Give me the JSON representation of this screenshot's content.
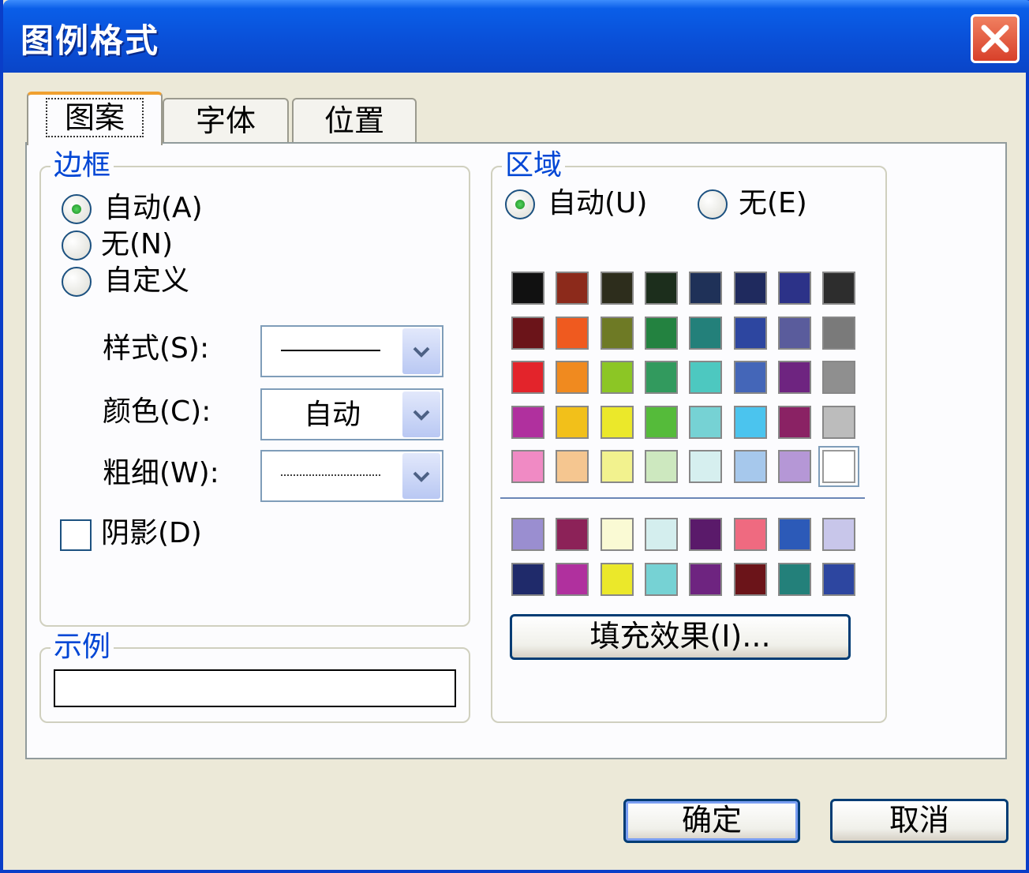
{
  "window": {
    "title": "图例格式"
  },
  "tabs": [
    {
      "label": "图案"
    },
    {
      "label": "字体"
    },
    {
      "label": "位置"
    }
  ],
  "border": {
    "group_label": "边框",
    "options": [
      {
        "label": "自动(A)",
        "selected": true
      },
      {
        "label": "无(N)",
        "selected": false
      },
      {
        "label": "自定义",
        "selected": false
      }
    ],
    "style_label": "样式(S):",
    "color_label": "颜色(C):",
    "color_value": "自动",
    "weight_label": "粗细(W):",
    "shadow_label": "阴影(D)",
    "shadow_checked": false
  },
  "sample": {
    "group_label": "示例"
  },
  "area": {
    "group_label": "区域",
    "auto_label": "自动(U)",
    "none_label": "无(E)",
    "auto_selected": true,
    "palette": [
      [
        "#111111",
        "#8c2a1b",
        "#2d2d1c",
        "#1c2e1c",
        "#1f3158",
        "#1f2a5e",
        "#2c3288",
        "#2d2d2d"
      ],
      [
        "#6b1419",
        "#ef5a1f",
        "#6e7a25",
        "#238240",
        "#23807a",
        "#2d46a0",
        "#5a5c9c",
        "#7a7a7a"
      ],
      [
        "#e3242b",
        "#f08a1f",
        "#8cc625",
        "#329a5e",
        "#4dc8c0",
        "#4466b8",
        "#6e2480",
        "#8f8f8f"
      ],
      [
        "#b0309e",
        "#f2c01a",
        "#ebe82a",
        "#55bb3a",
        "#76d2d4",
        "#4bc4ee",
        "#8a2264",
        "#bcbcbc"
      ],
      [
        "#f08ac4",
        "#f5c690",
        "#f2f28e",
        "#cde8bf",
        "#d6efef",
        "#a6c8ec",
        "#b597d6",
        "#ffffff"
      ]
    ],
    "palette_extra": [
      [
        "#9a8ed0",
        "#8c2258",
        "#fafad4",
        "#d4eeee",
        "#5a1a6a",
        "#ef6a80",
        "#2c5ab8",
        "#c8c6ea"
      ],
      [
        "#1f2a6a",
        "#b0309e",
        "#ebe82a",
        "#76d2d4",
        "#6e2480",
        "#6b1419",
        "#23807a",
        "#2d46a0"
      ]
    ],
    "selected_color": "#ffffff",
    "fill_effects_label": "填充效果(I)..."
  },
  "footer": {
    "ok_label": "确定",
    "cancel_label": "取消"
  }
}
